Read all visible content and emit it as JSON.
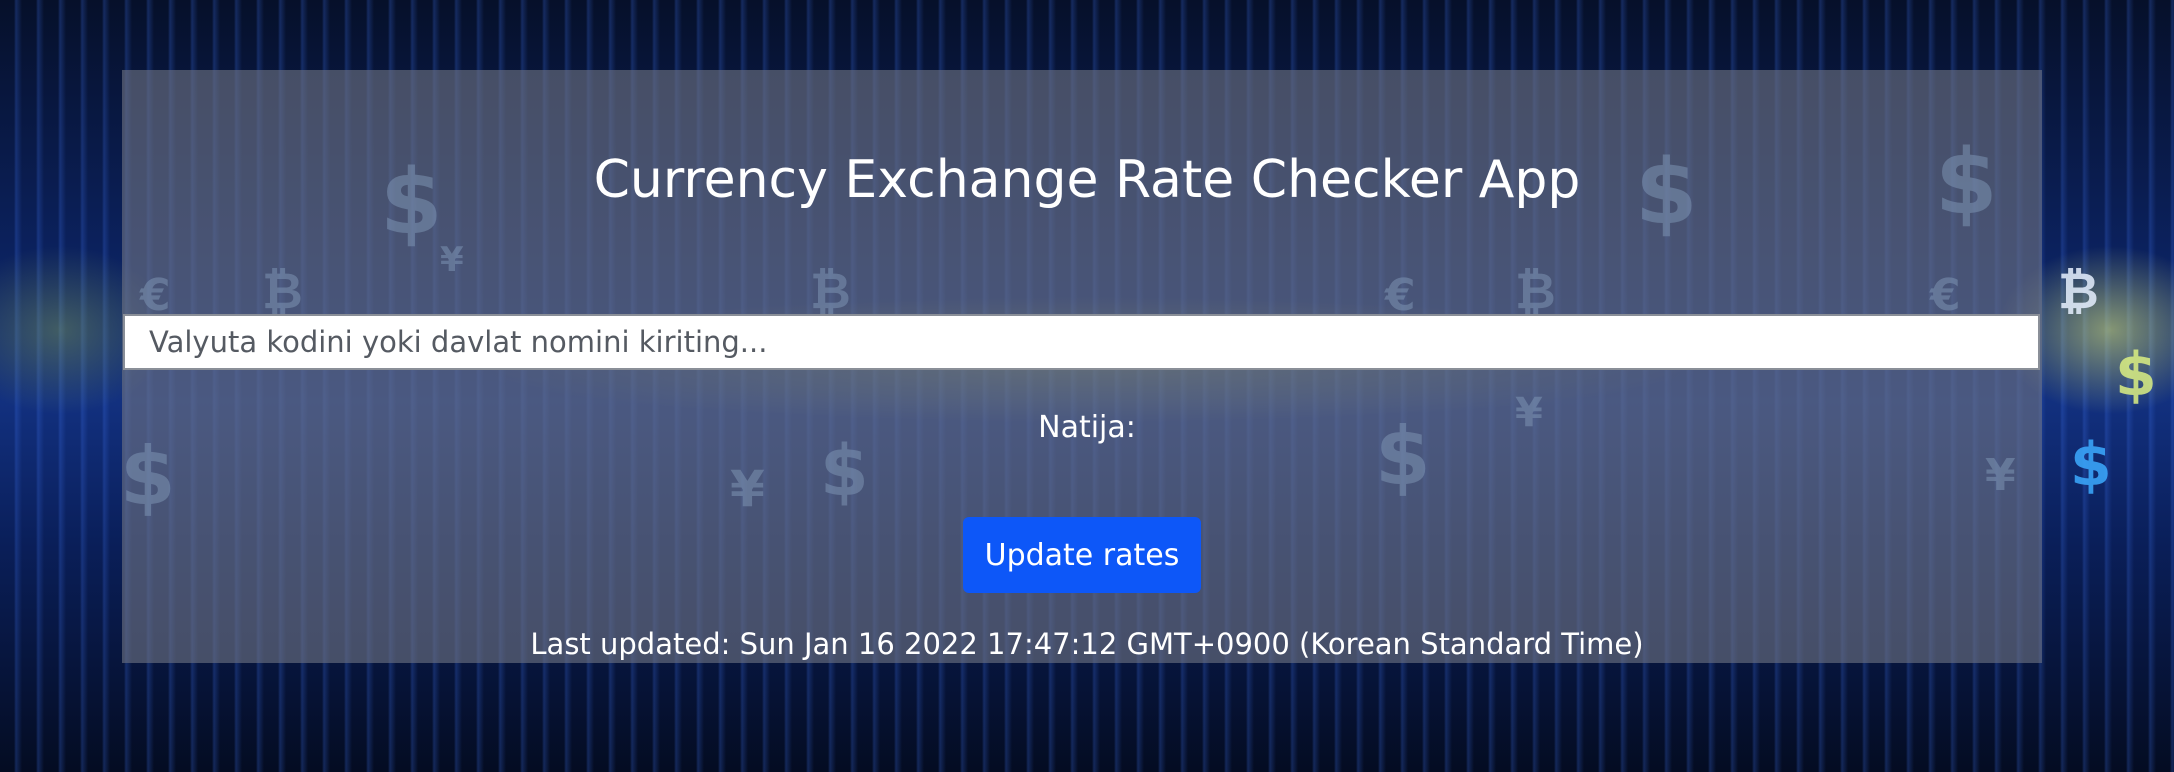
{
  "app": {
    "title": "Currency Exchange Rate Checker App"
  },
  "search": {
    "placeholder": "Valyuta kodini yoki davlat nomini kiriting...",
    "value": ""
  },
  "result": {
    "label": "Natija:"
  },
  "actions": {
    "update_label": "Update rates"
  },
  "status": {
    "last_updated": "Last updated: Sun Jan 16 2022 17:47:12 GMT+0900 (Korean Standard Time)"
  },
  "background": {
    "symbols": [
      "$",
      "¥",
      "€",
      "₿"
    ]
  },
  "colors": {
    "button": "#0d57f8",
    "panel": "rgba(110,115,130,0.62)",
    "text": "#ffffff"
  }
}
